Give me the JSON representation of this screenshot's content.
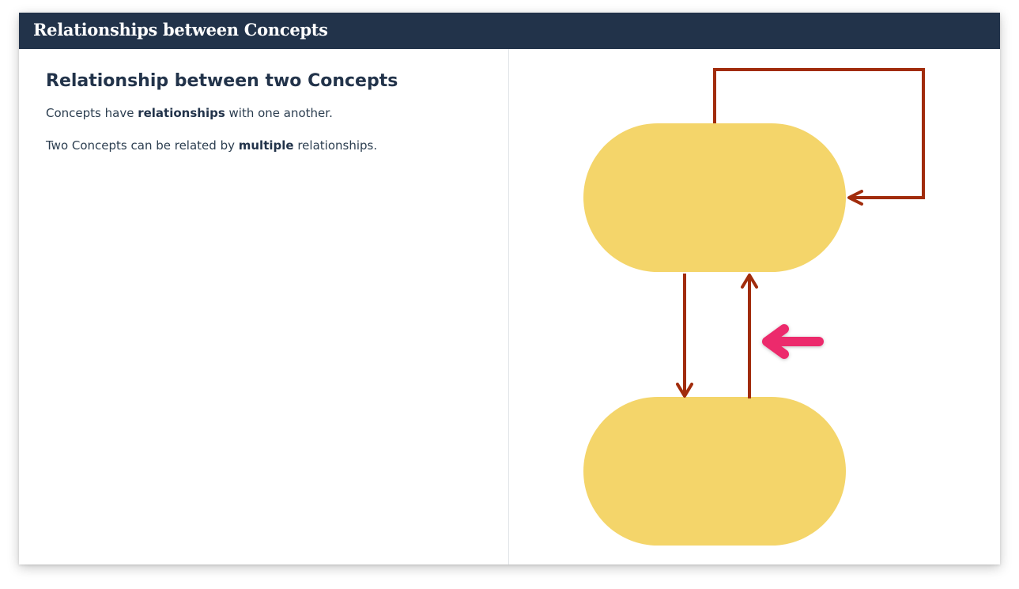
{
  "header": {
    "title": "Relationships between Concepts"
  },
  "content": {
    "heading": "Relationship between two Concepts",
    "paragraph1": {
      "before": "Concepts have ",
      "bold": "relationships",
      "after": " with one another."
    },
    "paragraph2": {
      "before": "Two Concepts can be related by ",
      "bold": "multiple",
      "after": " relationships."
    }
  },
  "diagram": {
    "nodes": [
      {
        "id": "concept-a"
      },
      {
        "id": "concept-b"
      }
    ],
    "relationships": [
      {
        "from": "concept-a",
        "to": "concept-a",
        "kind": "self-loop"
      },
      {
        "from": "concept-a",
        "to": "concept-b",
        "kind": "downward"
      },
      {
        "from": "concept-b",
        "to": "concept-a",
        "kind": "upward",
        "highlighted": true
      }
    ],
    "colors": {
      "node_fill": "#f4d56a",
      "relationship_line": "#a12c0c",
      "pointer_arrow": "#ec2c6c",
      "header_bg": "#22334a"
    },
    "pointer": {
      "icon": "pointer-arrow-icon",
      "points_to": "upward relationship"
    }
  }
}
